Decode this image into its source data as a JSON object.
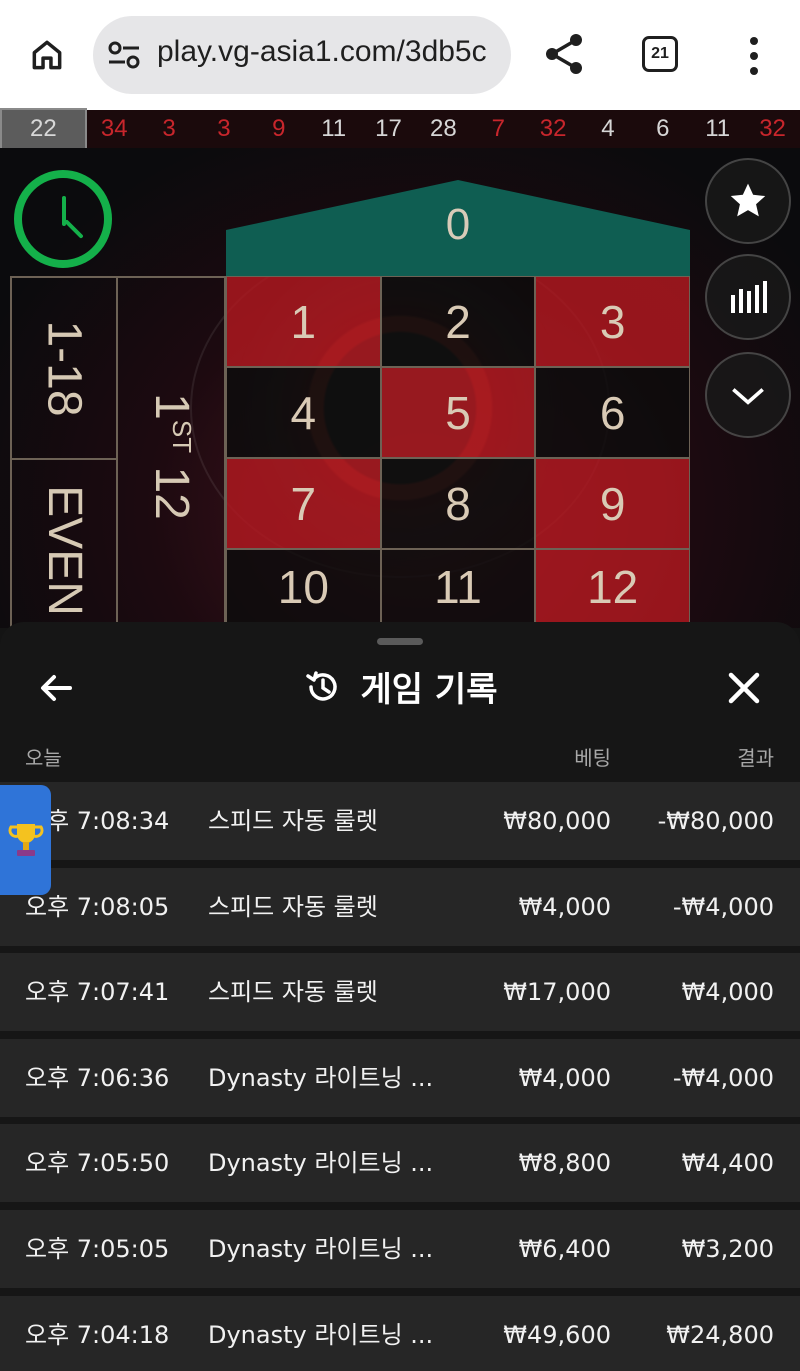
{
  "browser": {
    "url": "play.vg-asia1.com/3db5c",
    "tab_count": "21",
    "icons": [
      "home-icon",
      "tune-icon",
      "share-icon",
      "tabs-icon",
      "more-vert-icon"
    ]
  },
  "history_strip": {
    "numbers": [
      {
        "value": "22",
        "color": "gray"
      },
      {
        "value": "34",
        "color": "red"
      },
      {
        "value": "3",
        "color": "red"
      },
      {
        "value": "3",
        "color": "red"
      },
      {
        "value": "9",
        "color": "red"
      },
      {
        "value": "11",
        "color": "black"
      },
      {
        "value": "17",
        "color": "black"
      },
      {
        "value": "28",
        "color": "black"
      },
      {
        "value": "7",
        "color": "red"
      },
      {
        "value": "32",
        "color": "red"
      },
      {
        "value": "4",
        "color": "black"
      },
      {
        "value": "6",
        "color": "black"
      },
      {
        "value": "11",
        "color": "black"
      },
      {
        "value": "32",
        "color": "red"
      }
    ]
  },
  "table": {
    "zero": "0",
    "numbers": [
      {
        "value": "1",
        "color": "red"
      },
      {
        "value": "2",
        "color": "black"
      },
      {
        "value": "3",
        "color": "red"
      },
      {
        "value": "4",
        "color": "black"
      },
      {
        "value": "5",
        "color": "red"
      },
      {
        "value": "6",
        "color": "black"
      },
      {
        "value": "7",
        "color": "red"
      },
      {
        "value": "8",
        "color": "black"
      },
      {
        "value": "9",
        "color": "red"
      },
      {
        "value": "10",
        "color": "black"
      },
      {
        "value": "11",
        "color": "black"
      },
      {
        "value": "12",
        "color": "red"
      }
    ],
    "outside_low": "1-18",
    "outside_even": "EVEN",
    "dozen_prefix": "1",
    "dozen_suffix": "ST",
    "dozen_number": "12"
  },
  "sheet": {
    "title": "게임 기록",
    "headers": {
      "today": "오늘",
      "bet": "베팅",
      "result": "결과"
    },
    "rows": [
      {
        "time": "오후 7:08:34",
        "game": "스피드 자동 룰렛",
        "bet": "₩80,000",
        "result": "-₩80,000"
      },
      {
        "time": "오후 7:08:05",
        "game": "스피드 자동 룰렛",
        "bet": "₩4,000",
        "result": "-₩4,000"
      },
      {
        "time": "오후 7:07:41",
        "game": "스피드 자동 룰렛",
        "bet": "₩17,000",
        "result": "₩4,000"
      },
      {
        "time": "오후 7:06:36",
        "game": "Dynasty 라이트닝 ...",
        "bet": "₩4,000",
        "result": "-₩4,000"
      },
      {
        "time": "오후 7:05:50",
        "game": "Dynasty 라이트닝 ...",
        "bet": "₩8,800",
        "result": "₩4,400"
      },
      {
        "time": "오후 7:05:05",
        "game": "Dynasty 라이트닝 ...",
        "bet": "₩6,400",
        "result": "₩3,200"
      },
      {
        "time": "오후 7:04:18",
        "game": "Dynasty 라이트닝 ...",
        "bet": "₩49,600",
        "result": "₩24,800"
      }
    ]
  },
  "colors": {
    "timer_green": "#14b04a",
    "felt_green": "#0f5e52",
    "table_red": "#b21820",
    "trophy_tab_blue": "#2f74d8"
  }
}
